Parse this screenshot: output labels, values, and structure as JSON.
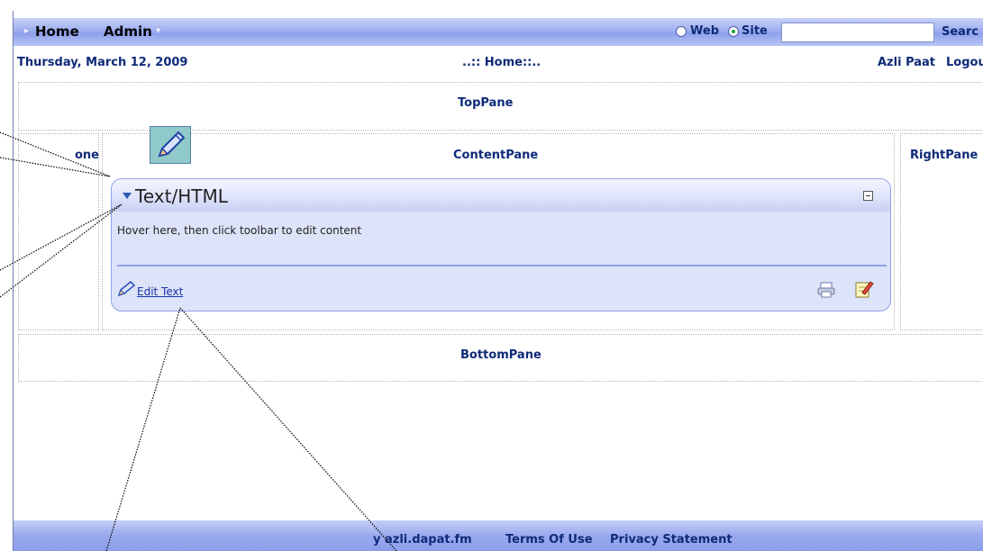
{
  "menu": {
    "items": [
      {
        "label": "Home"
      },
      {
        "label": "Admin"
      }
    ]
  },
  "search": {
    "options": [
      {
        "label": "Web",
        "selected": false
      },
      {
        "label": "Site",
        "selected": true
      }
    ],
    "input_value": "",
    "button_label": "Searc"
  },
  "info": {
    "date": "Thursday, March 12, 2009",
    "breadcrumb": "..:: Home::..",
    "user": "Azli Paat",
    "logout": "Logou"
  },
  "panes": {
    "top": "TopPane",
    "left": "one",
    "content": "ContentPane",
    "right": "RightPane",
    "bottom": "BottomPane"
  },
  "module": {
    "title": "Text/HTML",
    "body": "Hover here, then click toolbar to edit content",
    "edit_link": "Edit Text"
  },
  "footer": {
    "copyright": "y azli.dapat.fm",
    "terms": "Terms Of Use",
    "privacy": "Privacy Statement"
  },
  "icons": {
    "edit": "pencil-icon",
    "print": "print-icon",
    "edit_note": "edit-note-icon",
    "collapse": "triangle-down-icon",
    "minimize": "minimize-icon"
  },
  "colors": {
    "accent": "#0f2a78",
    "menubar": "#9eaef0",
    "module_bg": "#dde3f8"
  }
}
